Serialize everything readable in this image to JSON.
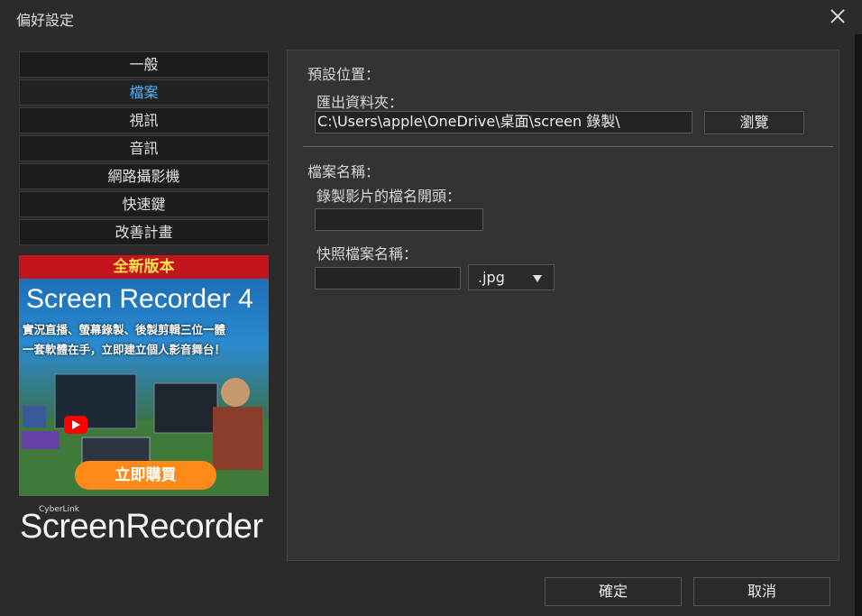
{
  "window": {
    "title": "偏好設定"
  },
  "sidebar": {
    "items": [
      {
        "label": "一般"
      },
      {
        "label": "檔案"
      },
      {
        "label": "視訊"
      },
      {
        "label": "音訊"
      },
      {
        "label": "網路攝影機"
      },
      {
        "label": "快速鍵"
      },
      {
        "label": "改善計畫"
      }
    ],
    "active_index": 1
  },
  "promo": {
    "top_banner": "全新版本",
    "heading": "Screen Recorder 4",
    "line1": "實況直播、螢幕錄製、後製剪輯三位一體",
    "line2": "一套軟體在手，立即建立個人影音舞台！",
    "cta": "立即購買"
  },
  "brand": {
    "company": "CyberLink",
    "product": "ScreenRecorder"
  },
  "default_location": {
    "section_label": "預設位置：",
    "export_folder_label": "匯出資料夾：",
    "export_folder_value": "C:\\Users\\apple\\OneDrive\\桌面\\screen 錄製\\",
    "browse_label": "瀏覽"
  },
  "file_name": {
    "section_label": "檔案名稱：",
    "recording_prefix_label": "錄製影片的檔名開頭：",
    "recording_prefix_value": "",
    "snapshot_label": "快照檔案名稱：",
    "snapshot_value": "",
    "snapshot_format": ".jpg"
  },
  "footer": {
    "ok": "確定",
    "cancel": "取消"
  },
  "colors": {
    "accent": "#4db3ff",
    "background": "#2b2b2b",
    "panel": "#333333",
    "cta": "#ff8a1a",
    "banner": "#c4151c"
  }
}
